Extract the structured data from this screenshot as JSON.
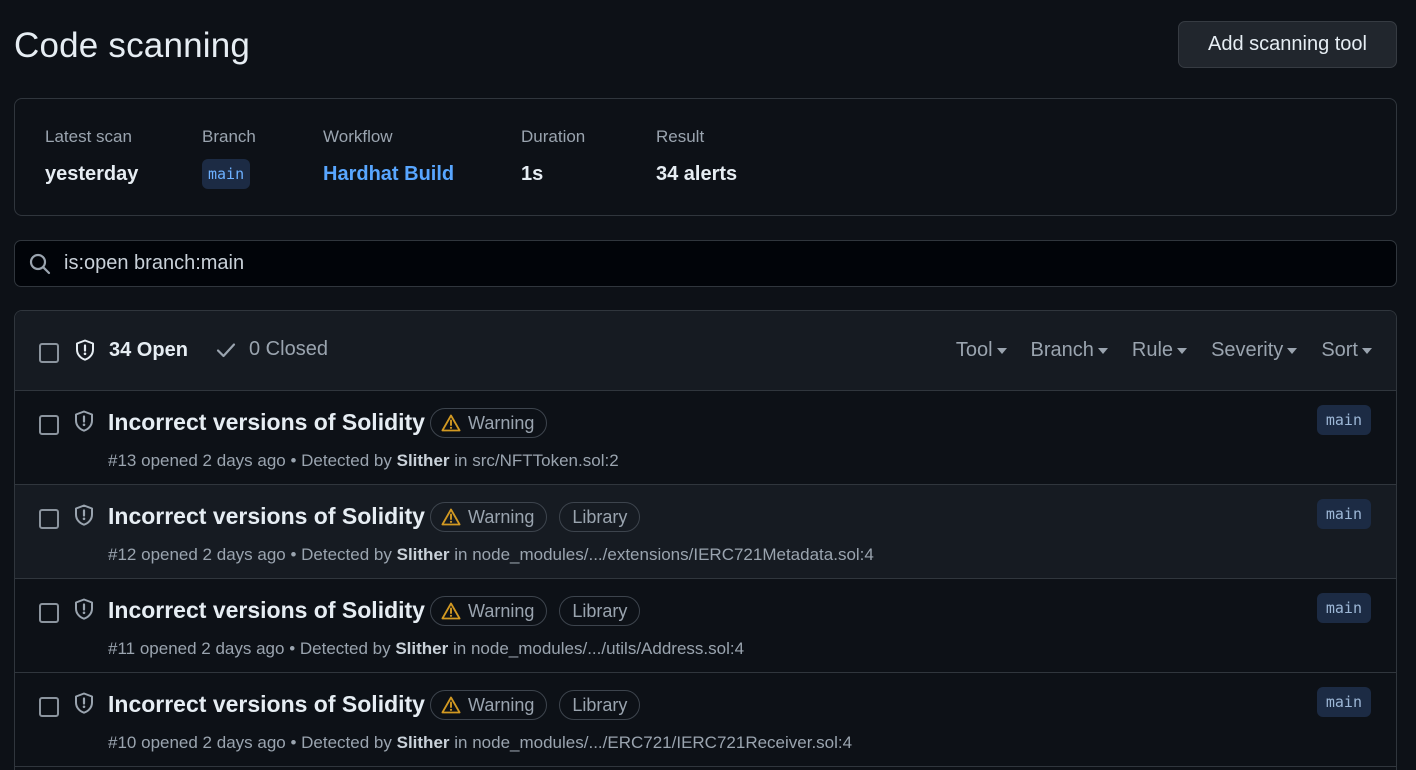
{
  "header": {
    "title": "Code scanning",
    "add_tool_label": "Add scanning tool"
  },
  "scan": {
    "latest_scan_label": "Latest scan",
    "latest_scan_value": "yesterday",
    "branch_label": "Branch",
    "branch_value": "main",
    "workflow_label": "Workflow",
    "workflow_value": "Hardhat Build",
    "duration_label": "Duration",
    "duration_value": "1s",
    "result_label": "Result",
    "result_value": "34 alerts"
  },
  "search": {
    "value": "is:open branch:main",
    "icon": "search-icon"
  },
  "list": {
    "open_label": "34 Open",
    "closed_label": "0 Closed",
    "filters": [
      "Tool",
      "Branch",
      "Rule",
      "Severity",
      "Sort"
    ],
    "alerts": [
      {
        "title": "Incorrect versions of Solidity",
        "severity": "Warning",
        "tag": "",
        "number": "#13",
        "opened": "opened 2 days ago",
        "detected_by_label": "Detected by",
        "tool": "Slither",
        "in_label": "in",
        "path": "src/NFTToken.sol:2",
        "branch": "main"
      },
      {
        "title": "Incorrect versions of Solidity",
        "severity": "Warning",
        "tag": "Library",
        "number": "#12",
        "opened": "opened 2 days ago",
        "detected_by_label": "Detected by",
        "tool": "Slither",
        "in_label": "in",
        "path": "node_modules/.../extensions/IERC721Metadata.sol:4",
        "branch": "main"
      },
      {
        "title": "Incorrect versions of Solidity",
        "severity": "Warning",
        "tag": "Library",
        "number": "#11",
        "opened": "opened 2 days ago",
        "detected_by_label": "Detected by",
        "tool": "Slither",
        "in_label": "in",
        "path": "node_modules/.../utils/Address.sol:4",
        "branch": "main"
      },
      {
        "title": "Incorrect versions of Solidity",
        "severity": "Warning",
        "tag": "Library",
        "number": "#10",
        "opened": "opened 2 days ago",
        "detected_by_label": "Detected by",
        "tool": "Slither",
        "in_label": "in",
        "path": "node_modules/.../ERC721/IERC721Receiver.sol:4",
        "branch": "main"
      }
    ]
  },
  "colors": {
    "background": "#0d1117",
    "link": "#58a6ff",
    "warning_icon": "#d29922"
  }
}
